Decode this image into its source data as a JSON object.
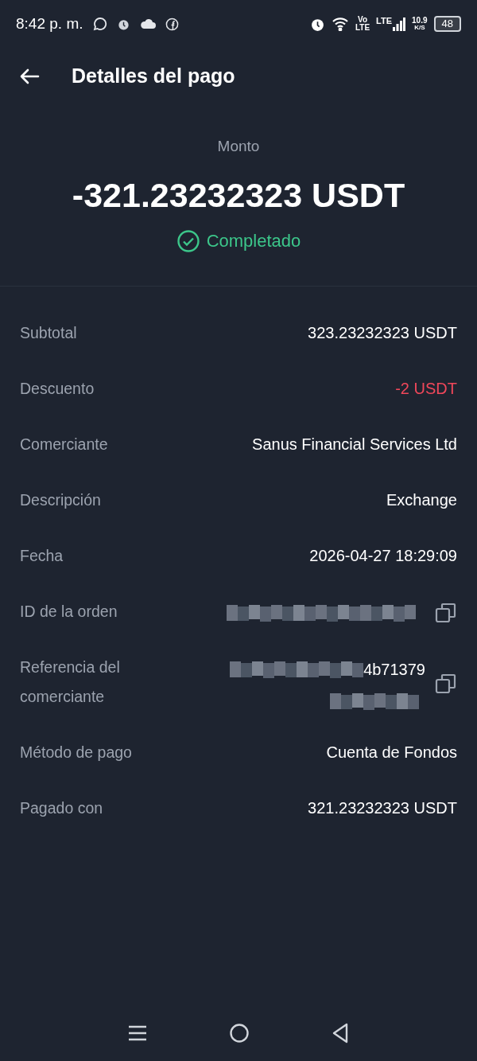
{
  "status_bar": {
    "time": "8:42 p. m.",
    "network": "10.9",
    "network_unit": "K/S",
    "battery": "48",
    "volte_top": "Vo",
    "volte_bottom": "LTE",
    "lte": "LTE"
  },
  "header": {
    "title": "Detalles del pago"
  },
  "summary": {
    "label": "Monto",
    "amount": "-321.23232323 USDT",
    "status": "Completado",
    "completed": true
  },
  "rows": [
    {
      "kind": "text",
      "label": "Subtotal",
      "value": "323.23232323 USDT",
      "negative": false
    },
    {
      "kind": "text",
      "label": "Descuento",
      "value": "-2 USDT",
      "negative": true
    },
    {
      "kind": "text",
      "label": "Comerciante",
      "value": "Sanus Financial Services Ltd",
      "negative": false
    },
    {
      "kind": "text",
      "label": "Descripción",
      "value": "Exchange",
      "negative": false
    },
    {
      "kind": "text",
      "label": "Fecha",
      "value": "2026-04-27 18:29:09",
      "negative": false
    },
    {
      "kind": "redacted",
      "label": "ID de la orden",
      "lines": [
        {
          "blurred": true
        }
      ]
    },
    {
      "kind": "redacted",
      "label": "Referencia del comerciante",
      "lines": [
        {
          "blurred": true,
          "tail": "4b71379"
        },
        {
          "blurred": true
        }
      ]
    },
    {
      "kind": "text",
      "label": "Método de pago",
      "value": "Cuenta de Fondos",
      "negative": false
    },
    {
      "kind": "text",
      "label": "Pagado con",
      "value": "321.23232323 USDT",
      "negative": false
    }
  ]
}
